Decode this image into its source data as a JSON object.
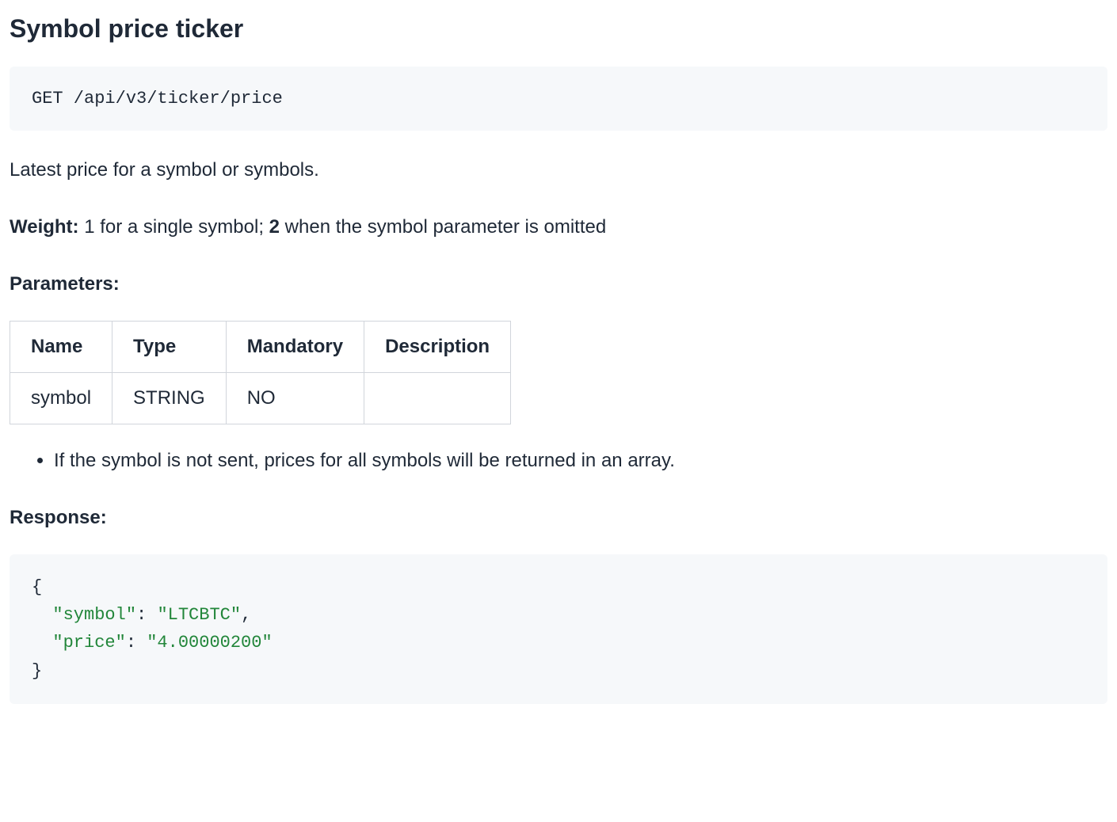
{
  "title": "Symbol price ticker",
  "endpoint": "GET /api/v3/ticker/price",
  "description": "Latest price for a symbol or symbols.",
  "weight": {
    "label": "Weight:",
    "part1": " 1 for a single symbol; ",
    "bold2": "2",
    "part2": " when the symbol parameter is omitted"
  },
  "params": {
    "label": "Parameters:",
    "headers": [
      "Name",
      "Type",
      "Mandatory",
      "Description"
    ],
    "rows": [
      {
        "name": "symbol",
        "type": "STRING",
        "mandatory": "NO",
        "description": ""
      }
    ]
  },
  "notes": [
    "If the symbol is not sent, prices for all symbols will be returned in an array."
  ],
  "response": {
    "label": "Response:",
    "tokens": {
      "open": "{",
      "line1_key": "\"symbol\"",
      "line1_colon": ": ",
      "line1_val": "\"LTCBTC\"",
      "line1_comma": ",",
      "line2_key": "\"price\"",
      "line2_colon": ": ",
      "line2_val": "\"4.00000200\"",
      "close": "}"
    }
  }
}
